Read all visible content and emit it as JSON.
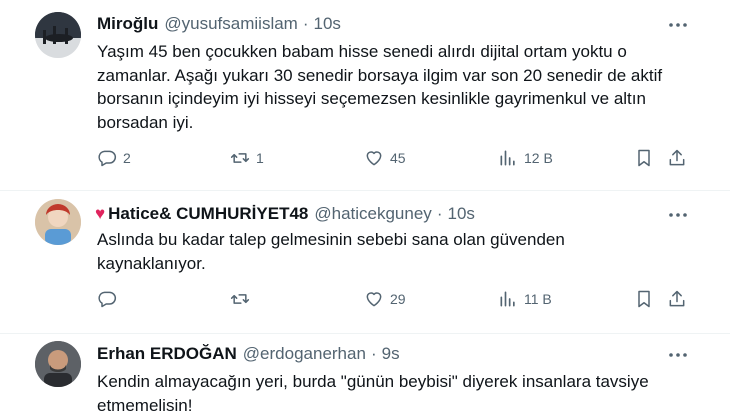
{
  "tweets": [
    {
      "name": "Miroğlu",
      "handle": "@yusufsamiislam",
      "time": "10s",
      "text": "Yaşım 45 ben çocukken babam hisse senedi alırdı dijital ortam yoktu o zamanlar. Aşağı yukarı 30 senedir borsaya ilgim var son 20 senedir de aktif borsanın içindeyim iyi hisseyi seçemezsen kesinlikle gayrimenkul ve altın borsadan iyi.",
      "replies": "2",
      "retweets": "1",
      "likes": "45",
      "views": "12 B"
    },
    {
      "name": "Hatice& CUMHURİYET48",
      "handle": "@haticekguney",
      "time": "10s",
      "text": "Aslında bu kadar talep gelmesinin sebebi sana olan güvenden kaynaklanıyor.",
      "replies": "",
      "retweets": "",
      "likes": "29",
      "views": "11 B"
    },
    {
      "name": "Erhan ERDOĞAN",
      "handle": "@erdoganerhan",
      "time": "9s",
      "text": "Kendin almayacağın yeri, burda \"günün beybisi\" diyerek insanlara tavsiye etmemelisin!"
    }
  ],
  "icons": {
    "reply": "reply-icon",
    "retweet": "retweet-icon",
    "like": "heart-icon",
    "views": "views-icon",
    "bookmark": "bookmark-icon",
    "share": "share-icon",
    "more": "more-icon",
    "badge": "red-heart-icon"
  },
  "colors": {
    "text": "#0f1419",
    "secondary": "#536471",
    "divider": "#eff3f4",
    "heart": "#e0245e"
  }
}
